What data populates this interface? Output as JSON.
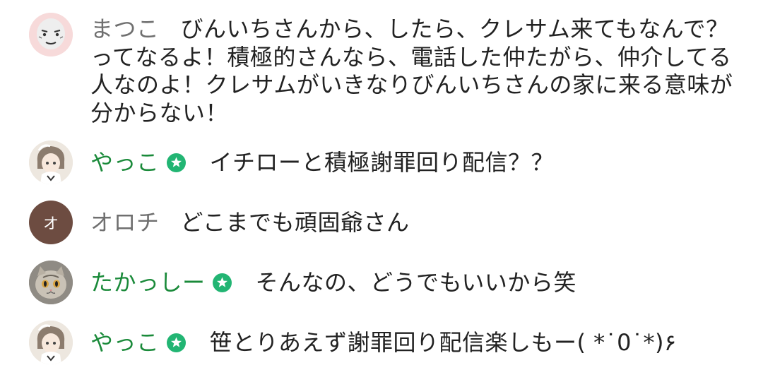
{
  "messages": [
    {
      "author": "まつこ",
      "avatar": "face-drawing-avatar",
      "verified": false,
      "text": "びんいちさんから、したら、クレサム来てもなんで？ってなるよ！積極的さんなら、電話した仲たがら、仲介してる人なのよ！クレサムがいきなりびんいちさんの家に来る意味が分からない！"
    },
    {
      "author": "やっこ",
      "avatar": "anime-girl-avatar",
      "verified": true,
      "text": "イチローと積極謝罪回り配信？？"
    },
    {
      "author": "オロチ",
      "avatar": "letter-avatar",
      "avatar_letter": "オ",
      "avatar_color": "#6d4c41",
      "verified": false,
      "text": "どこまでも頑固爺さん"
    },
    {
      "author": "たかっしー",
      "avatar": "cat-avatar",
      "verified": true,
      "text": "そんなの、どうでもいいから笑"
    },
    {
      "author": "やっこ",
      "avatar": "anime-girl-avatar",
      "verified": true,
      "text": "笹とりあえず謝罪回り配信楽しもー( *˙0˙*)۶"
    }
  ],
  "colors": {
    "author_default": "#6f6f6f",
    "author_verified": "#1a8a3a",
    "badge": "#22b573",
    "text": "#222222"
  }
}
